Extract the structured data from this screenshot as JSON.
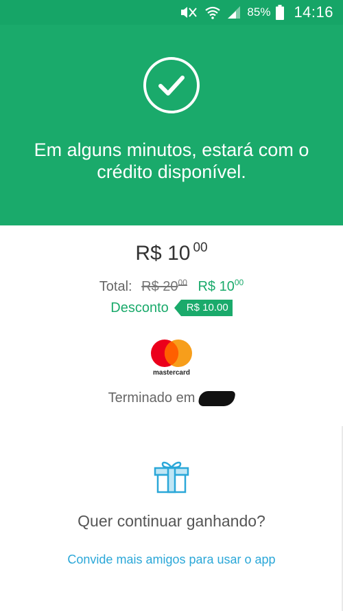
{
  "status_bar": {
    "battery_percent": "85%",
    "time": "14:16",
    "icons": [
      "mute-icon",
      "wifi-icon",
      "signal-icon",
      "battery-icon"
    ]
  },
  "hero": {
    "icon": "check-circle-icon",
    "message": "Em alguns minutos, estará com o crédito disponível."
  },
  "payment": {
    "price_main": "R$ 10",
    "price_main_cents": "00",
    "total_label": "Total:",
    "total_old": "R$ 20",
    "total_old_cents": "00",
    "total_new": "R$ 10",
    "total_new_cents": "00",
    "discount_label": "Desconto",
    "discount_value": "R$ 10.00"
  },
  "card": {
    "brand": "mastercard",
    "ending_label": "Terminado em"
  },
  "promo": {
    "icon": "gift-icon",
    "question": "Quer continuar ganhando?",
    "link": "Convide mais amigos para usar o app"
  },
  "colors": {
    "primary_green": "#1aaa6b",
    "status_green": "#16a567",
    "link_blue": "#2aa7d8",
    "mastercard_red": "#eb001b",
    "mastercard_orange": "#f79e1b"
  }
}
